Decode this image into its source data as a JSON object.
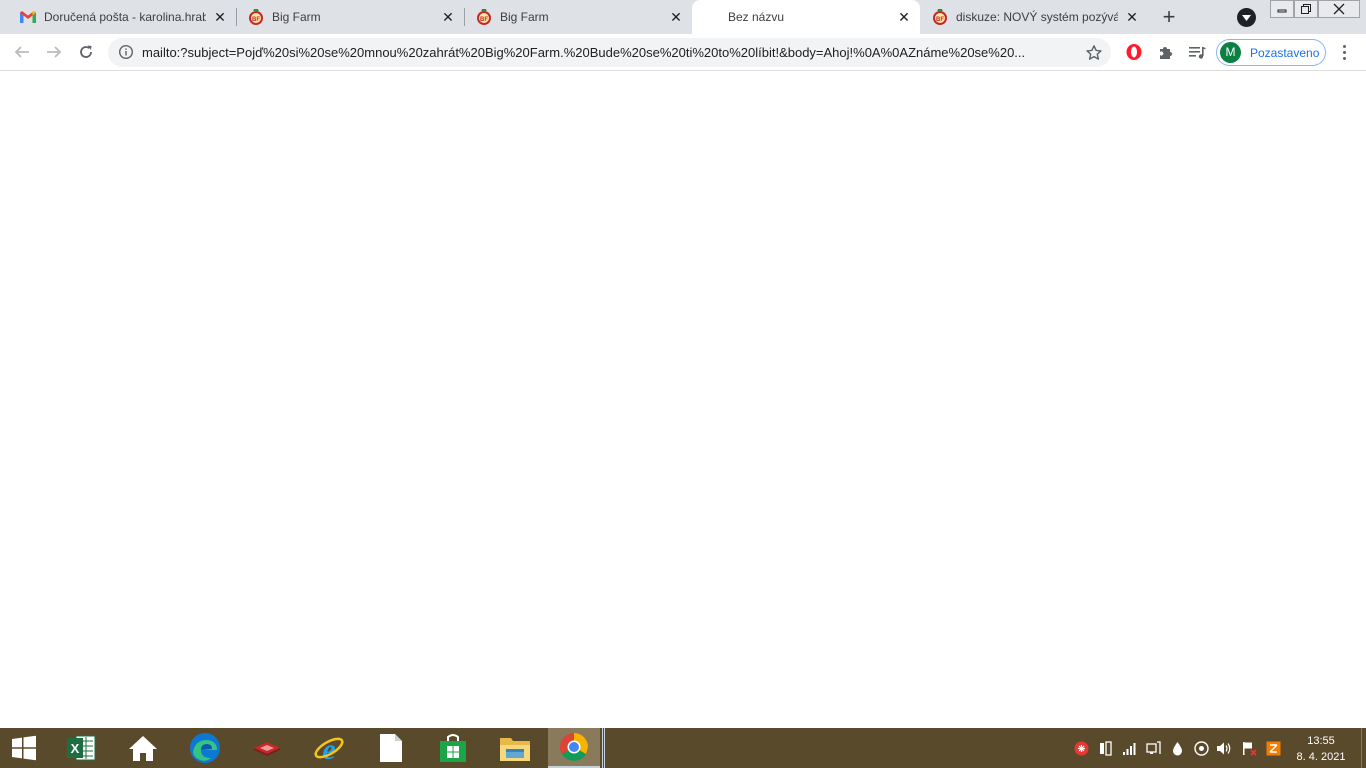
{
  "tabs": [
    {
      "title": "Doručená pošta - karolina.hrab",
      "favicon": "gmail-icon"
    },
    {
      "title": "Big Farm",
      "favicon": "bigfarm-icon"
    },
    {
      "title": "Big Farm",
      "favicon": "bigfarm-icon"
    },
    {
      "title": "Bez názvu",
      "favicon": "none",
      "active": true
    },
    {
      "title": "diskuze: NOVÝ systém pozývání",
      "favicon": "bigfarm-icon"
    }
  ],
  "address_bar": {
    "url": "mailto:?subject=Pojď%20si%20se%20mnou%20zahrát%20Big%20Farm.%20Bude%20se%20ti%20to%20líbit!&body=Ahoj!%0A%0AZnáme%20se%20..."
  },
  "profile": {
    "initial": "M",
    "label": "Pozastaveno"
  },
  "clock": {
    "time": "13:55",
    "date": "8. 4. 2021"
  },
  "colors": {
    "tabstrip": "#dee1e6",
    "taskbar": "#5a4a2c",
    "profile_accent": "#1a73e8",
    "avatar": "#0b8043"
  }
}
